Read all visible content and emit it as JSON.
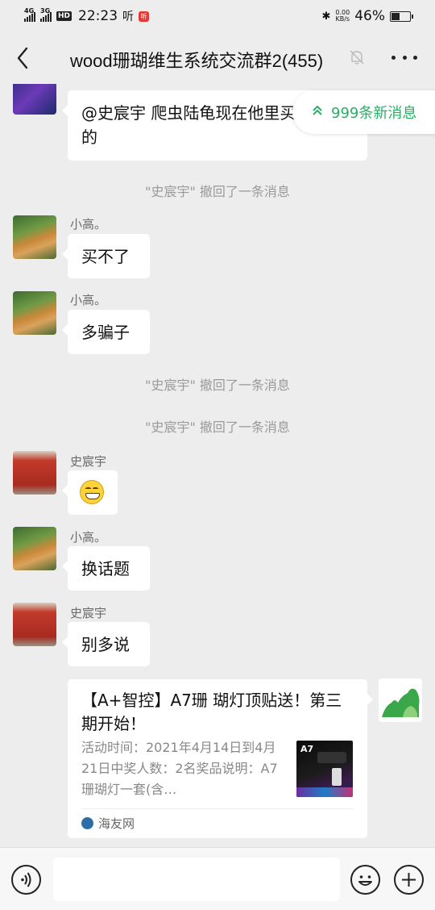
{
  "status_bar": {
    "net1": "4G",
    "net2": "3G",
    "hd": "HD",
    "time": "22:23",
    "app_glyph": "听",
    "notification_badge": "听",
    "speed_value": "0.00",
    "speed_unit": "KB/s",
    "battery": "46%",
    "battery_level": 0.46
  },
  "header": {
    "title": "wood珊瑚维生系统交流群2(455)",
    "icons": [
      "back-arrow-icon",
      "bell-muted-icon",
      "more-dots-icon"
    ]
  },
  "unread_pill": {
    "text": "999条新消息",
    "icon": "double-chevron-up-icon",
    "color": "#2aae67"
  },
  "messages": [
    {
      "kind": "text",
      "sender": "",
      "avatar": "fish-tank-avatar",
      "text": "@史宸宇  爬虫陆龟现在他里买的"
    },
    {
      "kind": "system",
      "text": "\"史宸宇\" 撤回了一条消息"
    },
    {
      "kind": "text",
      "sender": "小高。",
      "avatar": "cat-avatar",
      "text": "买不了"
    },
    {
      "kind": "text",
      "sender": "小高。",
      "avatar": "cat-avatar",
      "text": "多骗子"
    },
    {
      "kind": "system",
      "text": "\"史宸宇\" 撤回了一条消息"
    },
    {
      "kind": "system",
      "text": "\"史宸宇\" 撤回了一条消息"
    },
    {
      "kind": "emoji",
      "sender": "史宸宇",
      "avatar": "red-door-avatar",
      "emoji": "grinning-face-icon"
    },
    {
      "kind": "text",
      "sender": "小高。",
      "avatar": "cat-avatar",
      "text": "换话题"
    },
    {
      "kind": "text",
      "sender": "史宸宇",
      "avatar": "red-door-avatar",
      "text": "别多说"
    },
    {
      "kind": "link_card",
      "avatar": "green-silhouette-avatar",
      "title": "【A+智控】A7珊 瑚灯顶贴送！第三期开始！",
      "description": "活动时间：2021年4月14日到4月21日中奖人数：2名奖品说明：A7珊瑚灯一套(含…",
      "thumb_text": "A7",
      "source": "海友网"
    }
  ],
  "input_bar": {
    "value": "",
    "icons": [
      "voice-icon",
      "emoji-icon",
      "plus-icon"
    ]
  },
  "colors": {
    "background": "#ededed",
    "bubble": "#ffffff",
    "accent_green": "#2aae67"
  }
}
